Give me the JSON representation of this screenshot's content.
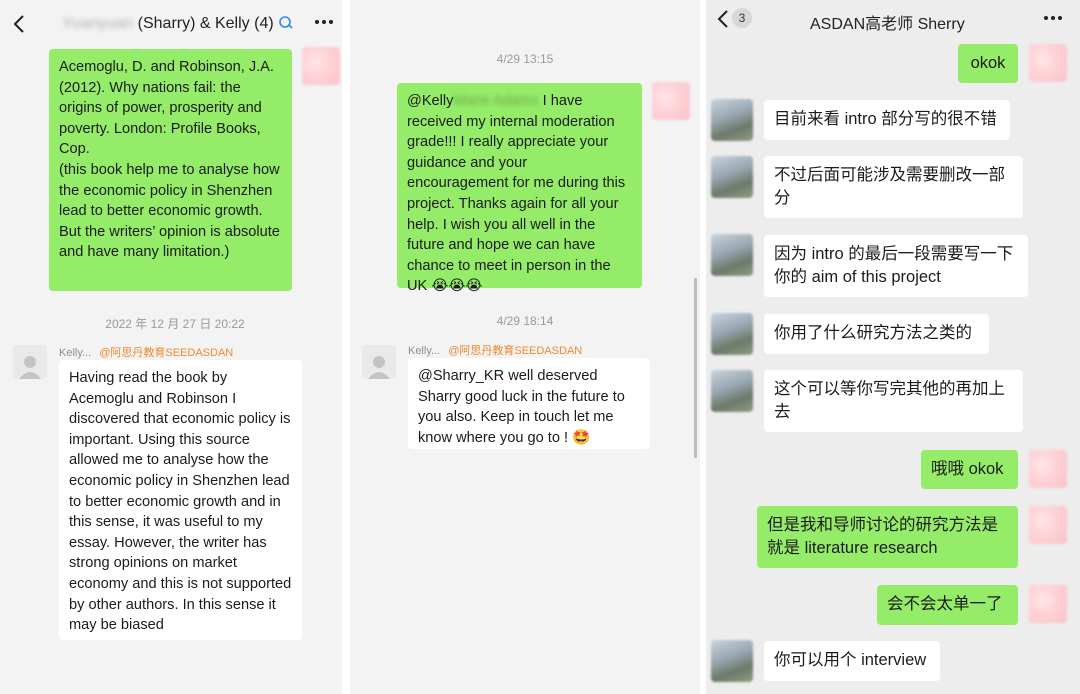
{
  "panel1": {
    "header": {
      "back_icon": "chevron-left-icon",
      "blurred_name": "Yuanyuan",
      "title": "(Sharry) & Kelly (4)",
      "menu_icon": "more-dots-icon"
    },
    "messages": {
      "m1": "Acemoglu, D. and Robinson, J.A. (2012). Why nations fail: the origins of power, prosperity and poverty. London: Profile Books, Cop.\n(this book help me to analyse how the economic policy in Shenzhen lead to better economic growth. But the writers’ opinion is absolute and have many limitation.)",
      "timestamp": "2022 年 12 月 27 日 20:22",
      "sender_name": "Kelly...",
      "sender_org": "@阿思丹教育SEEDASDAN",
      "m2": "Having read the book by Acemoglu and Robinson I discovered that economic policy is important. Using this source allowed me to analyse how the economic policy in Shenzhen lead to better economic growth and in this sense, it was useful to my essay. However, the writer has strong opinions on market economy and this is not supported by other authors. In this sense it may be biased"
    }
  },
  "panel2": {
    "timestamp1": "4/29 13:15",
    "m1_prefix": "@Kelly",
    "m1_blurred": "Marie Adams",
    "m1_text": " I have received my internal moderation grade!!! I really appreciate your guidance and your encouragement for me during this project. Thanks again for all your help. I wish you all well in the future and hope we can have chance to meet in person in the UK 😭😭😭",
    "timestamp2": "4/29 18:14",
    "sender_name": "Kelly...",
    "sender_org": "@阿思丹教育SEEDASDAN",
    "m2": "@Sharry_KR well deserved Sharry good luck in the future to you also. Keep in touch let me know where you go to ! 🤩"
  },
  "panel3": {
    "header": {
      "back_icon": "chevron-left-icon",
      "unread_count": "3",
      "title": "ASDAN高老师 Sherry",
      "menu_icon": "more-dots-icon"
    },
    "messages": {
      "m1": "okok",
      "m2": "目前来看 intro 部分写的很不错",
      "m3": "不过后面可能涉及需要删改一部分",
      "m4": "因为 intro 的最后一段需要写一下你的 aim of this project",
      "m5": "你用了什么研究方法之类的",
      "m6": "这个可以等你写完其他的再加上去",
      "m7": "哦哦 okok",
      "m8": "但是我和导师讨论的研究方法是就是 literature research",
      "m9": "会不会太单一了",
      "m10": "你可以用个 interview"
    }
  },
  "colors": {
    "sent_bubble": "#95ec69",
    "received_bubble": "#ffffff",
    "org_text": "#f08a2f"
  }
}
